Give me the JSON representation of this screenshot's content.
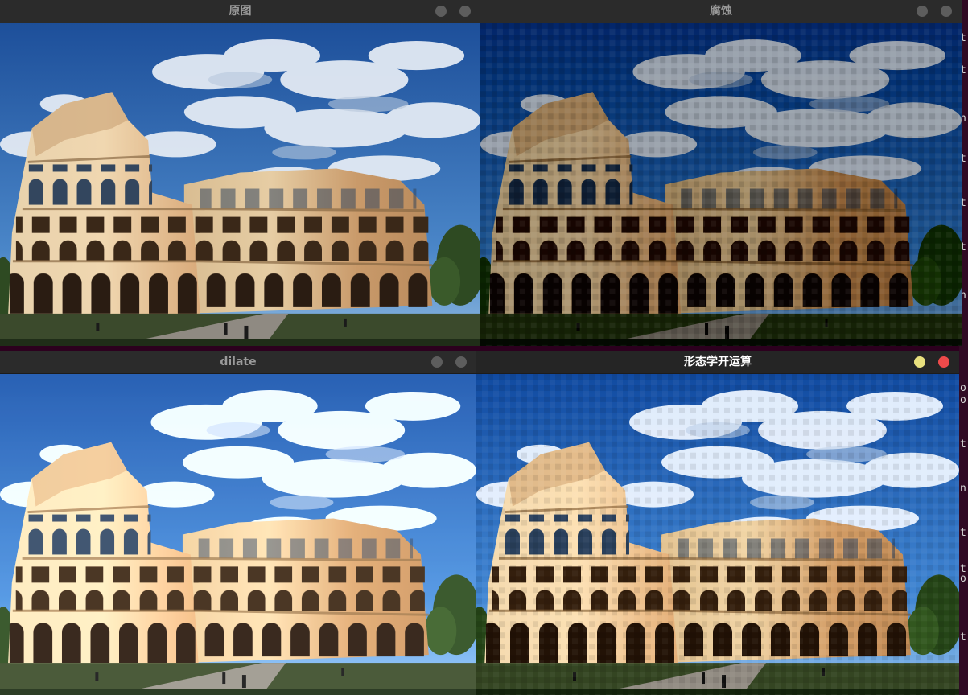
{
  "windows": [
    {
      "id": "original",
      "title": "原图",
      "active": false
    },
    {
      "id": "erode",
      "title": "腐蚀",
      "active": false
    },
    {
      "id": "dilate",
      "title": "dilate",
      "active": false
    },
    {
      "id": "opening",
      "title": "形态学开运算",
      "active": true
    }
  ],
  "background_terminal": {
    "right_edge_chars": [
      "t",
      "t",
      "n",
      "t",
      "t",
      "t",
      "n",
      "o",
      "o",
      "t",
      "n",
      "t",
      "t",
      "o",
      "t"
    ],
    "partial_line": "... .... ........"
  },
  "colors": {
    "sky_top": "#1d4f9a",
    "sky_bottom": "#6fa2d8",
    "cloud": "#e8eef6",
    "stone_light": "#e2c79c",
    "stone_dark": "#8a6a45",
    "grass": "#2f4a23",
    "active_close": "#ee4a4a",
    "active_min": "#e8e07e"
  },
  "image_description_icon": "colosseum-photo"
}
